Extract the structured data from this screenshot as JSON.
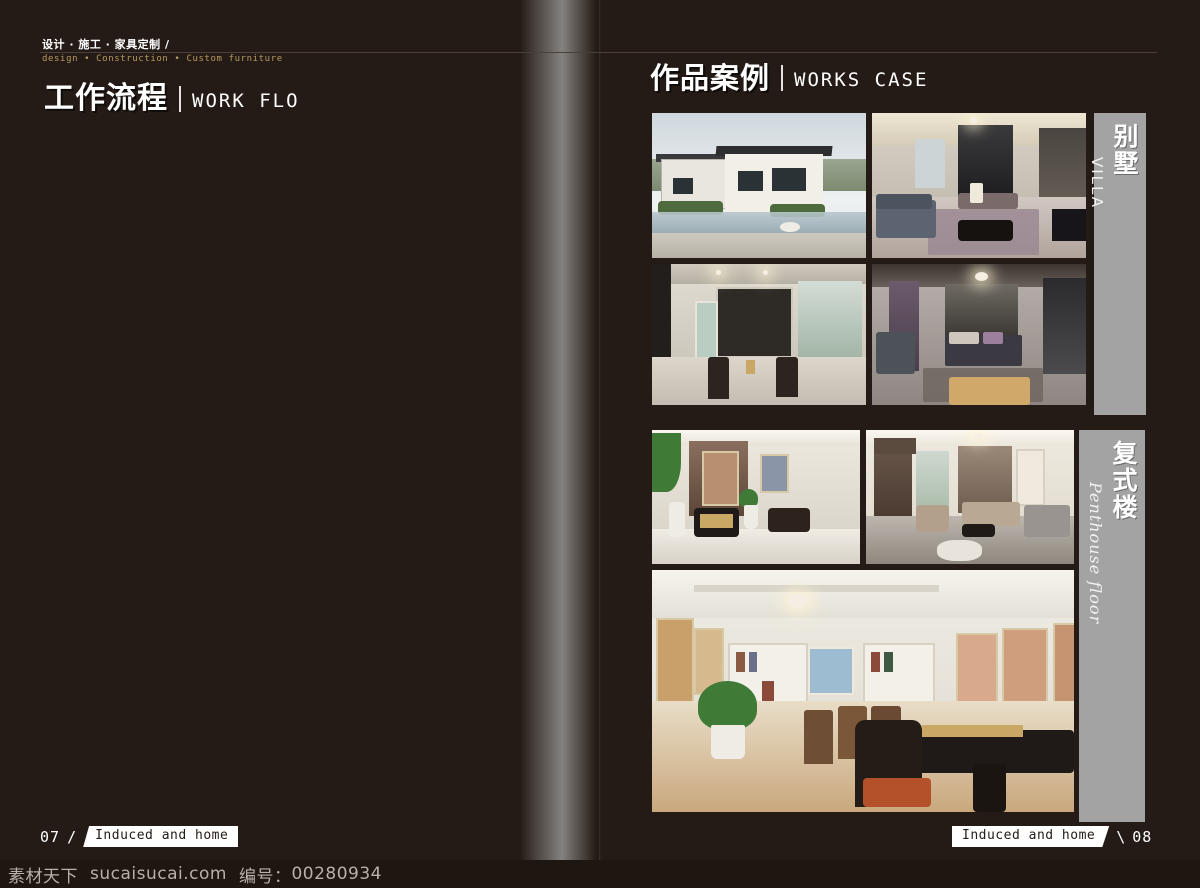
{
  "page": {
    "background_color": "#241b16",
    "accent_color": "#b79a62",
    "tab_color": "#a3a3a3"
  },
  "left_page": {
    "kicker_cn": "设计 · 施工 · 家具定制 /",
    "kicker_en": "design • Construction • Custom furniture",
    "title_cn": "工作流程",
    "title_en": "WORK FLO",
    "footer": {
      "page_number": "07",
      "separator": "/",
      "brand": "Induced and home"
    }
  },
  "right_page": {
    "title_cn": "作品案例",
    "title_en": "WORKS CASE",
    "groups": [
      {
        "id": "villa",
        "tab_cn": "别墅",
        "tab_en": "VILLA",
        "photos": [
          {
            "name": "villa-exterior",
            "caption": "modern villa exterior with terraced garden"
          },
          {
            "name": "villa-living-room",
            "caption": "luxury living room with grey sofa and marble floor"
          },
          {
            "name": "villa-dining-hall",
            "caption": "open hall with display cabinets and two dark chairs"
          },
          {
            "name": "villa-master-bedroom",
            "caption": "master bedroom with chandelier and purple curtains"
          }
        ]
      },
      {
        "id": "penthouse",
        "tab_cn": "复式楼",
        "tab_en": "Penthouse floor",
        "photos": [
          {
            "name": "penthouse-entry-hall",
            "caption": "entry hall with console table and artwork"
          },
          {
            "name": "penthouse-sitting-room",
            "caption": "sitting room with draped curtains and sofas"
          },
          {
            "name": "penthouse-dining-library",
            "caption": "dining area with bookshelves, chandelier and orange chair"
          }
        ]
      }
    ],
    "footer": {
      "brand": "Induced and home",
      "separator": "\\",
      "page_number": "08"
    }
  },
  "watermark": {
    "site_cn": "素材天下",
    "site_url": "sucaisucai.com",
    "id_label": "编号：",
    "id_value": "00280934"
  }
}
